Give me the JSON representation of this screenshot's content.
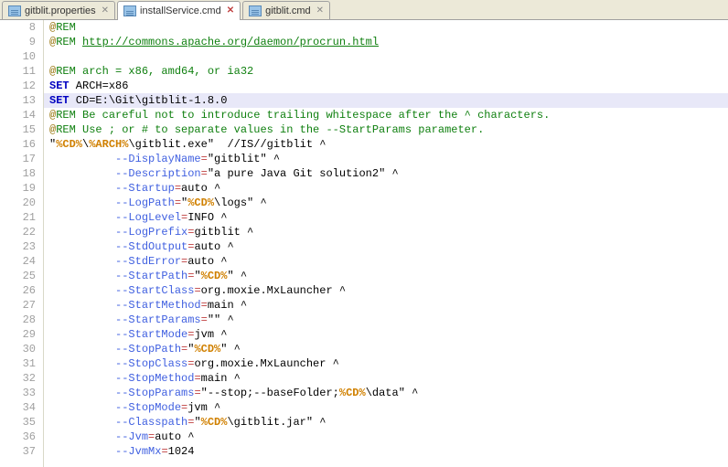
{
  "tabs": [
    {
      "label": "gitblit.properties",
      "active": false,
      "dirty": false
    },
    {
      "label": "installService.cmd",
      "active": true,
      "dirty": true
    },
    {
      "label": "gitblit.cmd",
      "active": false,
      "dirty": false
    }
  ],
  "first_line": 8,
  "highlighted_line": 13,
  "code": [
    {
      "t": "rem",
      "pre": "@",
      "rem": "REM"
    },
    {
      "t": "remurl",
      "pre": "@",
      "rem": "REM ",
      "url": "http://commons.apache.org/daemon/procrun.html"
    },
    {
      "t": "blank"
    },
    {
      "t": "rem",
      "pre": "@",
      "rem": "REM arch = x86, amd64, or ia32"
    },
    {
      "t": "set",
      "kw": "SET",
      "rest": " ARCH=x86"
    },
    {
      "t": "set",
      "kw": "SET",
      "rest": " CD=E:\\Git\\gitblit-1.8.0"
    },
    {
      "t": "rem",
      "pre": "@",
      "rem": "REM Be careful not to introduce trailing whitespace after the ^ characters."
    },
    {
      "t": "rem",
      "pre": "@",
      "rem": "REM Use ; or # to separate values in the --StartParams parameter."
    },
    {
      "t": "exe",
      "q1": "\"",
      "v1": "%CD%",
      "mid1": "\\",
      "v2": "%ARCH%",
      "mid2": "\\gitblit.exe\"",
      "rest": "  //IS//gitblit ^"
    },
    {
      "t": "opt",
      "indent": "          ",
      "opt": "--DisplayName",
      "eq": "=",
      "val": "\"gitblit\"",
      "tail": " ^"
    },
    {
      "t": "opt",
      "indent": "          ",
      "opt": "--Description",
      "eq": "=",
      "val": "\"a pure Java Git solution2\"",
      "tail": " ^"
    },
    {
      "t": "opt",
      "indent": "          ",
      "opt": "--Startup",
      "eq": "=",
      "val": "auto",
      "tail": " ^"
    },
    {
      "t": "optv",
      "indent": "          ",
      "opt": "--LogPath",
      "eq": "=",
      "q": "\"",
      "var": "%CD%",
      "after": "\\logs\"",
      "tail": " ^"
    },
    {
      "t": "opt",
      "indent": "          ",
      "opt": "--LogLevel",
      "eq": "=",
      "val": "INFO",
      "tail": " ^"
    },
    {
      "t": "opt",
      "indent": "          ",
      "opt": "--LogPrefix",
      "eq": "=",
      "val": "gitblit",
      "tail": " ^"
    },
    {
      "t": "opt",
      "indent": "          ",
      "opt": "--StdOutput",
      "eq": "=",
      "val": "auto",
      "tail": " ^"
    },
    {
      "t": "opt",
      "indent": "          ",
      "opt": "--StdError",
      "eq": "=",
      "val": "auto",
      "tail": " ^"
    },
    {
      "t": "optv",
      "indent": "          ",
      "opt": "--StartPath",
      "eq": "=",
      "q": "\"",
      "var": "%CD%",
      "after": "\"",
      "tail": " ^"
    },
    {
      "t": "opt",
      "indent": "          ",
      "opt": "--StartClass",
      "eq": "=",
      "val": "org.moxie.MxLauncher",
      "tail": " ^"
    },
    {
      "t": "opt",
      "indent": "          ",
      "opt": "--StartMethod",
      "eq": "=",
      "val": "main",
      "tail": " ^"
    },
    {
      "t": "opt",
      "indent": "          ",
      "opt": "--StartParams",
      "eq": "=",
      "val": "\"\"",
      "tail": " ^"
    },
    {
      "t": "opt",
      "indent": "          ",
      "opt": "--StartMode",
      "eq": "=",
      "val": "jvm",
      "tail": " ^"
    },
    {
      "t": "optv",
      "indent": "          ",
      "opt": "--StopPath",
      "eq": "=",
      "q": "\"",
      "var": "%CD%",
      "after": "\"",
      "tail": " ^"
    },
    {
      "t": "opt",
      "indent": "          ",
      "opt": "--StopClass",
      "eq": "=",
      "val": "org.moxie.MxLauncher",
      "tail": " ^"
    },
    {
      "t": "opt",
      "indent": "          ",
      "opt": "--StopMethod",
      "eq": "=",
      "val": "main",
      "tail": " ^"
    },
    {
      "t": "optv2",
      "indent": "          ",
      "opt": "--StopParams",
      "eq": "=",
      "before": "\"--stop;--baseFolder;",
      "var": "%CD%",
      "after": "\\data\"",
      "tail": " ^"
    },
    {
      "t": "opt",
      "indent": "          ",
      "opt": "--StopMode",
      "eq": "=",
      "val": "jvm",
      "tail": " ^"
    },
    {
      "t": "optv",
      "indent": "          ",
      "opt": "--Classpath",
      "eq": "=",
      "q": "\"",
      "var": "%CD%",
      "after": "\\gitblit.jar\"",
      "tail": " ^"
    },
    {
      "t": "opt",
      "indent": "          ",
      "opt": "--Jvm",
      "eq": "=",
      "val": "auto",
      "tail": " ^"
    },
    {
      "t": "opt",
      "indent": "          ",
      "opt": "--JvmMx",
      "eq": "=",
      "val": "1024",
      "tail": ""
    }
  ]
}
